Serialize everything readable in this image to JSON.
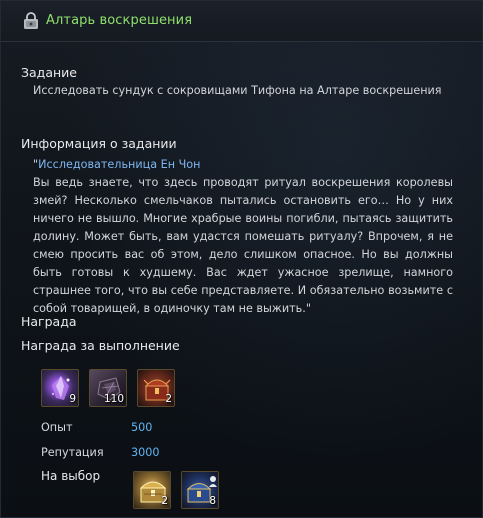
{
  "window": {
    "title": "Алтарь воскрешения",
    "quest_icon": "lock-quest-icon"
  },
  "task": {
    "label": "Задание",
    "text": "Исследовать сундук с сокровищами Тифона на Алтаре воскрешения"
  },
  "info": {
    "label": "Информация о задании",
    "open_quote": "\"",
    "speaker": "Исследовательница Ен Чон",
    "body": "Вы ведь знаете, что здесь проводят ритуал воскрешения королевы змей? Несколько смельчаков пытались остановить его… Но у них ничего не вышло. Многие храбрые воины погибли, пытаясь защитить долину. Может быть, вам удастся помешать ритуалу? Впрочем, я не смею просить вас об этом, дело слишком опасное. Но вы должны быть готовы к худшему. Вас ждет ужасное зрелище, намного страшнее того, что вы себе представляете. И обязательно возьмите с собой товарищей, в одиночку там не выжить.\""
  },
  "rewards": {
    "label": "Награда",
    "completion_label": "Награда за выполнение",
    "items": [
      {
        "icon": "purple-crystal-icon",
        "count": "9"
      },
      {
        "icon": "dark-stone-icon",
        "count": "110"
      },
      {
        "icon": "red-chest-icon",
        "count": "2"
      }
    ],
    "exp_label": "Опыт",
    "exp_value": "500",
    "rep_label": "Репутация",
    "rep_value": "3000",
    "choice_label": "На выбор",
    "choice_items": [
      {
        "icon": "gold-chest-icon",
        "count": "2"
      },
      {
        "icon": "blue-gold-chest-icon",
        "count": "8"
      }
    ]
  },
  "colors": {
    "title": "#8ee06b",
    "speaker": "#7fb6ef",
    "value": "#5fb4f0"
  }
}
